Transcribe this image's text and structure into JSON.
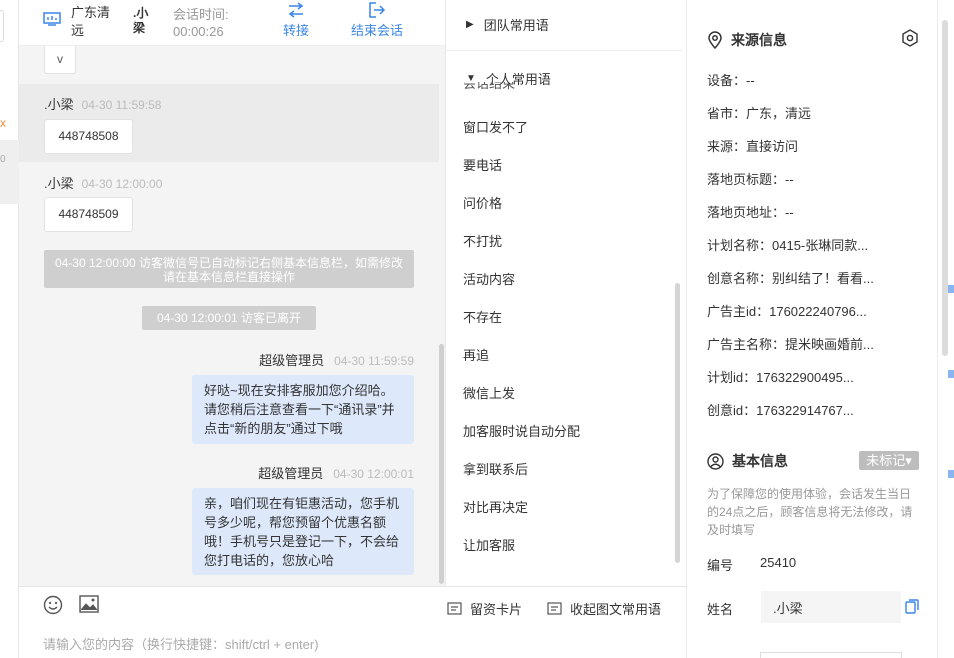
{
  "header": {
    "region": "广东清远",
    "visitor_name": ".小梁",
    "session_time_label": "会话时间:",
    "session_time": "00:00:26",
    "transfer_label": "转接",
    "end_session_label": "结束会话"
  },
  "chat": {
    "partial_bubble": "v",
    "messages": [
      {
        "sender": ".小梁",
        "time": "04-30 11:59:58",
        "text": "448748508"
      },
      {
        "sender": ".小梁",
        "time": "04-30 12:00:00",
        "text": "448748509"
      }
    ],
    "system_notice_1": "04-30 12:00:00 访客微信号已自动标记右侧基本信息栏，如需修改请在基本信息栏直接操作",
    "system_notice_2": "04-30 12:00:01 访客已离开",
    "agent_messages": [
      {
        "sender": "超级管理员",
        "time": "04-30 11:59:59",
        "text": "好哒~现在安排客服加您介绍哈。请您稍后注意查看一下“通讯录”并点击“新的朋友”通过下哦"
      },
      {
        "sender": "超级管理员",
        "time": "04-30 12:00:01",
        "text": "亲，咱们现在有钜惠活动，您手机号多少呢，帮您预留个优惠名额哦！手机号只是登记一下，不会给您打电话的，您放心哈"
      }
    ]
  },
  "input": {
    "placeholder": "请输入您的内容（换行快捷键：shift/ctrl + enter)",
    "card_label": "留资卡片",
    "collapse_label": "收起图文常用语"
  },
  "phrases": {
    "team_group": "团队常用语",
    "personal_group": "个人常用语",
    "clipped_item": "会话结束",
    "items": [
      "窗口发不了",
      "要电话",
      "问价格",
      "不打扰",
      "活动内容",
      "不存在",
      "再追",
      "微信上发",
      "加客服时说自动分配",
      "拿到联系后",
      "对比再决定",
      "让加客服"
    ]
  },
  "source_info": {
    "title": "来源信息",
    "rows": [
      "设备：--",
      "省市：广东，清远",
      "来源：直接访问",
      "落地页标题：--",
      "落地页地址：--",
      "计划名称：0415-张琳同款...",
      "创意名称：别纠结了！看看...",
      "广告主id：176022240796...",
      "广告主名称：提米映画婚前...",
      "计划id：176322900495...",
      "创意id：176322914767..."
    ]
  },
  "basic_info": {
    "title": "基本信息",
    "tag": "未标记▾",
    "note": "为了保障您的使用体验，会话发生当日的24点之后，顾客信息将无法修改，请及时填写",
    "id_label": "编号",
    "id_value": "25410",
    "name_label": "姓名",
    "name_value": ".小梁"
  },
  "colors": {
    "accent": "#3a86e8",
    "agent_bubble": "#dde9fb",
    "system_notice": "#cfcfcf",
    "chat_bg": "#f4f4f4"
  }
}
